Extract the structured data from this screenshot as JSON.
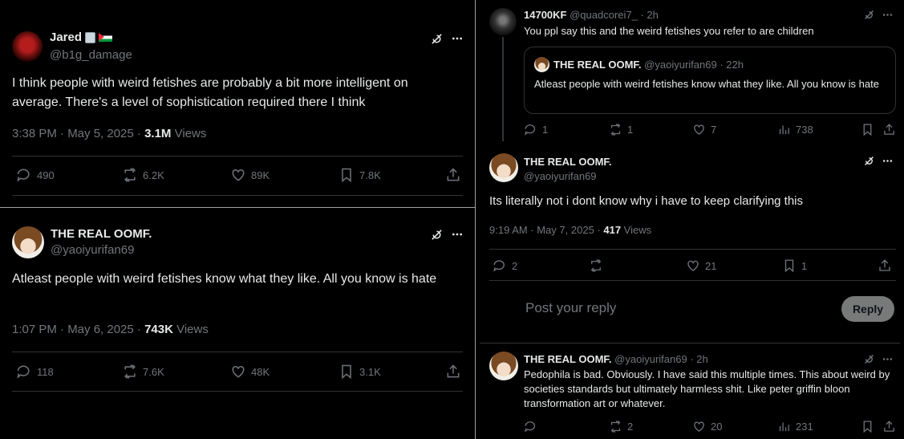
{
  "left": {
    "post1": {
      "name": "Jared",
      "handle": "@b1g_damage",
      "text": "I think people with weird fetishes are probably a bit more intelligent on average. There's a level of sophistication required there I think",
      "time": "3:38 PM · May 5, 2025 · ",
      "views_count": "3.1M",
      "views_label": " Views",
      "replies": "490",
      "reposts": "6.2K",
      "likes": "89K",
      "bookmarks": "7.8K"
    },
    "post2": {
      "name": "THE REAL OOMF.",
      "handle": "@yaoiyurifan69",
      "text": "Atleast people with weird fetishes know what they like. All you know is hate",
      "time": "1:07 PM · May 6, 2025 · ",
      "views_count": "743K",
      "views_label": " Views",
      "replies": "118",
      "reposts": "7.6K",
      "likes": "48K",
      "bookmarks": "3.1K"
    }
  },
  "right": {
    "reply1": {
      "name": "14700KF",
      "handle": "@quadcorei7_",
      "time": " · 2h",
      "text": "You ppl say this and the weird fetishes you refer to are children",
      "quote": {
        "name": "THE REAL OOMF.",
        "handle": "@yaoiyurifan69",
        "time": " · 22h",
        "text": "Atleast people with weird fetishes know what they like. All you know is hate"
      },
      "replies": "1",
      "reposts": "1",
      "likes": "7",
      "views": "738"
    },
    "main": {
      "name": "THE REAL OOMF.",
      "handle": "@yaoiyurifan69",
      "text": "Its literally not i dont know why i have to keep clarifying this",
      "time": "9:19 AM · May 7, 2025 · ",
      "views_count": "417",
      "views_label": " Views",
      "replies": "2",
      "likes": "21",
      "bookmarks": "1"
    },
    "composer": {
      "placeholder": "Post your reply",
      "button": "Reply"
    },
    "reply2": {
      "name": "THE REAL OOMF.",
      "handle": "@yaoiyurifan69",
      "time": " · 2h",
      "text": "Pedophila is bad. Obviously. I have said this multiple times. This about weird by societies standards  but ultimately harmless shit. Like peter griffin bloon transformation art or whatever.",
      "reposts": "2",
      "likes": "20",
      "views": "231"
    }
  }
}
